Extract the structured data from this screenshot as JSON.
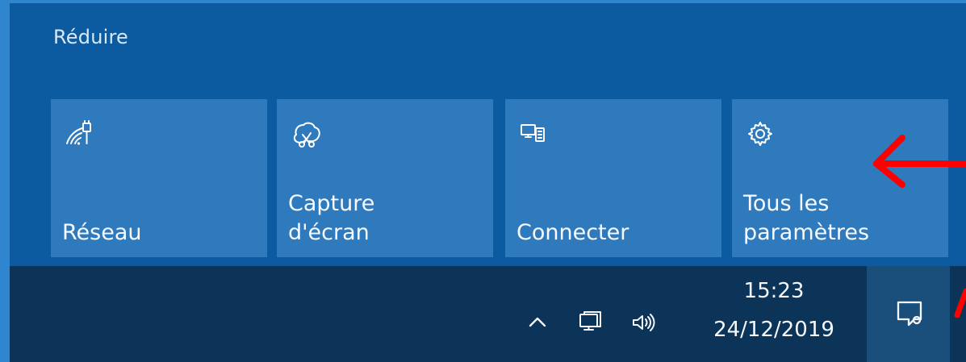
{
  "action_center": {
    "collapse_label": "Réduire",
    "tiles": [
      {
        "label": "Réseau",
        "icon": "network-signal-icon"
      },
      {
        "label": "Capture\nd'écran",
        "icon": "screen-snip-icon"
      },
      {
        "label": "Connecter",
        "icon": "connect-displays-icon"
      },
      {
        "label": "Tous les\nparamètres",
        "icon": "gear-icon"
      }
    ]
  },
  "taskbar": {
    "tray_icons": [
      "chevron-up-icon",
      "network-icon",
      "volume-icon"
    ],
    "clock": {
      "time": "15:23",
      "date": "24/12/2019"
    },
    "notification_icon": "notification-center-icon"
  },
  "annotations": {
    "arrow_color": "#ff0000"
  },
  "colors": {
    "frame_border": "#2f86cf",
    "panel_background": "#0c5a9f",
    "tile_background": "#2f79bd",
    "taskbar_background": "#0b3458",
    "notification_button_background": "#1a4f7c",
    "text": "#ffffff"
  }
}
